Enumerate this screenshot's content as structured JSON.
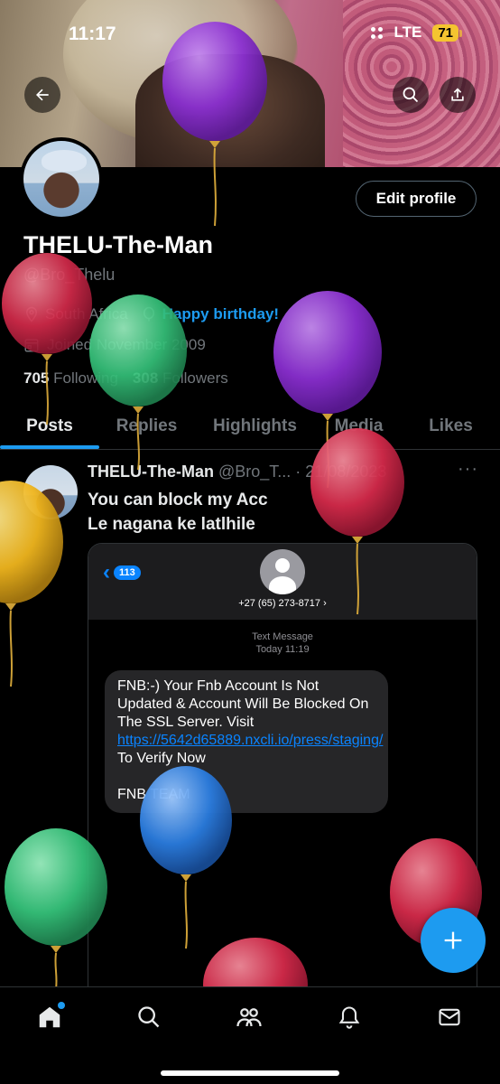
{
  "status_bar": {
    "time": "11:17",
    "network": "LTE",
    "battery": "71"
  },
  "profile": {
    "display_name": "THELU-The-Man",
    "handle": "@Bro_Thelu",
    "location": "South Africa",
    "birthday": "Happy birthday!",
    "joined": "Joined November 2009",
    "following_count": "705",
    "following_label": "Following",
    "followers_count": "308",
    "followers_label": "Followers",
    "edit_label": "Edit profile"
  },
  "tabs": [
    "Posts",
    "Replies",
    "Highlights",
    "Media",
    "Likes"
  ],
  "post": {
    "author": "THELU-The-Man",
    "handle_date": "@Bro_T... · 21/08/2023",
    "more": "···",
    "line1": "You can block my Acc",
    "line2": "Le nagana ke latlhile"
  },
  "sms": {
    "back_count": "113",
    "number": "+27 (65) 273-8717 ›",
    "meta_line1": "Text Message",
    "meta_line2": "Today 11:19",
    "body_before": "FNB:-) Your Fnb Account Is Not Updated & Account Will Be Blocked On The SSL Server. Visit ",
    "link": "https://5642d65889.nxcli.io/press/staging/",
    "body_after": " To Verify Now",
    "signature": "FNB TEAM"
  },
  "colors": {
    "accent": "#1d9bf0",
    "background": "#000000",
    "muted": "#71767b"
  },
  "icons": {
    "back": "arrow-left-icon",
    "search": "search-icon",
    "share": "share-icon",
    "location": "location-pin-icon",
    "birthday": "balloon-icon",
    "joined": "calendar-icon",
    "fab": "plus-icon",
    "nav": [
      "home-icon",
      "search-icon",
      "communities-icon",
      "bell-icon",
      "mail-icon"
    ]
  }
}
